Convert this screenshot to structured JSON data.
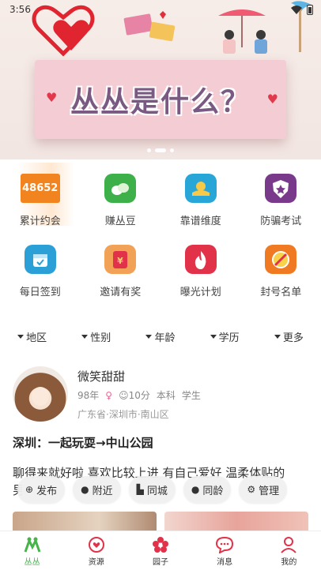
{
  "status_bar": {
    "time": "3:56"
  },
  "banner": {
    "title": "丛丛是什么？"
  },
  "grid": [
    {
      "label": "累计约会",
      "value": "48652",
      "icon": "counter-badge",
      "color": "#f2841f"
    },
    {
      "label": "赚丛豆",
      "icon": "beans-icon",
      "color": "#3db04a"
    },
    {
      "label": "靠谱维度",
      "icon": "handshake-icon",
      "color": "#29a6d8"
    },
    {
      "label": "防骗考试",
      "icon": "shield-star-icon",
      "color": "#7a3a8c"
    },
    {
      "label": "每日签到",
      "icon": "calendar-check-icon",
      "color": "#2aa0d6"
    },
    {
      "label": "邀请有奖",
      "icon": "red-envelope-icon",
      "color": "#f2a256"
    },
    {
      "label": "曝光计划",
      "icon": "flame-icon",
      "color": "#e2324a"
    },
    {
      "label": "封号名单",
      "icon": "ban-icon",
      "color": "#f07a22"
    }
  ],
  "filters": [
    "地区",
    "性别",
    "年龄",
    "学历",
    "更多"
  ],
  "post": {
    "username": "微笑甜甜",
    "birth_year": "98年",
    "gender_symbol": "♀",
    "score": "10分",
    "education": "本科",
    "occupation": "学生",
    "location": "广东省·深圳市·南山区",
    "title": "深圳：一起玩耍→中山公园",
    "body": "聊得来就好啦 喜欢比较上进 有自己爱好 温柔体贴的",
    "body_cut": "男"
  },
  "chips": [
    {
      "label": "发布",
      "icon": "plus-circle-icon"
    },
    {
      "label": "附近",
      "icon": "person-icon"
    },
    {
      "label": "同城",
      "icon": "city-icon"
    },
    {
      "label": "同龄",
      "icon": "person-icon"
    },
    {
      "label": "管理",
      "icon": "gear-icon"
    }
  ],
  "tabs": [
    {
      "label": "丛丛",
      "active": true
    },
    {
      "label": "资源"
    },
    {
      "label": "园子"
    },
    {
      "label": "消息"
    },
    {
      "label": "我的"
    }
  ],
  "colors": {
    "accent": "#46b44b",
    "primary_red": "#e2324a"
  }
}
